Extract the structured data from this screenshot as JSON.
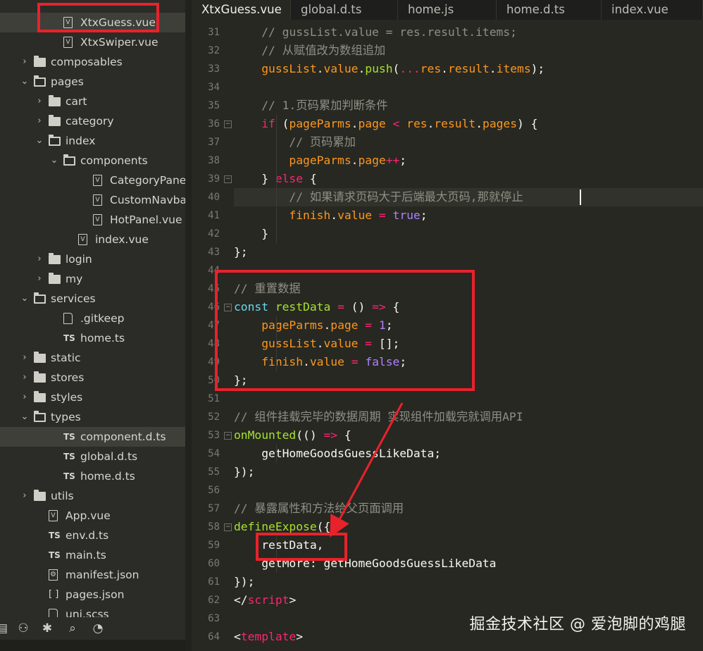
{
  "sidebar": {
    "rows": [
      {
        "label": "XtxGuess.vue",
        "type": "vue",
        "depth": 3,
        "selected": true
      },
      {
        "label": "XtxSwiper.vue",
        "type": "vue",
        "depth": 3
      },
      {
        "label": "composables",
        "type": "folder",
        "depth": 1
      },
      {
        "label": "pages",
        "type": "folder-open",
        "depth": 1
      },
      {
        "label": "cart",
        "type": "folder",
        "depth": 2
      },
      {
        "label": "category",
        "type": "folder",
        "depth": 2
      },
      {
        "label": "index",
        "type": "folder-open",
        "depth": 2
      },
      {
        "label": "components",
        "type": "folder-open",
        "depth": 3
      },
      {
        "label": "CategoryPanel...",
        "type": "vue",
        "depth": 5
      },
      {
        "label": "CustomNavbar...",
        "type": "vue",
        "depth": 5
      },
      {
        "label": "HotPanel.vue",
        "type": "vue",
        "depth": 5
      },
      {
        "label": "index.vue",
        "type": "vue",
        "depth": 4
      },
      {
        "label": "login",
        "type": "folder",
        "depth": 2
      },
      {
        "label": "my",
        "type": "folder",
        "depth": 2
      },
      {
        "label": "services",
        "type": "folder-open",
        "depth": 1
      },
      {
        "label": ".gitkeep",
        "type": "doc",
        "depth": 3
      },
      {
        "label": "home.ts",
        "type": "ts",
        "depth": 3
      },
      {
        "label": "static",
        "type": "folder",
        "depth": 1
      },
      {
        "label": "stores",
        "type": "folder",
        "depth": 1
      },
      {
        "label": "styles",
        "type": "folder",
        "depth": 1
      },
      {
        "label": "types",
        "type": "folder-open",
        "depth": 1
      },
      {
        "label": "component.d.ts",
        "type": "ts",
        "depth": 3,
        "selected": true
      },
      {
        "label": "global.d.ts",
        "type": "ts",
        "depth": 3
      },
      {
        "label": "home.d.ts",
        "type": "ts",
        "depth": 3
      },
      {
        "label": "utils",
        "type": "folder",
        "depth": 1
      },
      {
        "label": "App.vue",
        "type": "vue",
        "depth": 2
      },
      {
        "label": "env.d.ts",
        "type": "ts",
        "depth": 2
      },
      {
        "label": "main.ts",
        "type": "ts",
        "depth": 2
      },
      {
        "label": "manifest.json",
        "type": "gear",
        "depth": 2
      },
      {
        "label": "pages.json",
        "type": "bracket",
        "depth": 2
      },
      {
        "label": "uni.scss",
        "type": "doc",
        "depth": 2
      }
    ],
    "toolbar_icons": [
      "explorer-icon",
      "extensions-icon",
      "debug-icon",
      "search-icon",
      "plugin-icon"
    ]
  },
  "tabs": [
    {
      "label": "XtxGuess.vue",
      "active": true
    },
    {
      "label": "global.d.ts"
    },
    {
      "label": "home.js"
    },
    {
      "label": "home.d.ts"
    },
    {
      "label": "index.vue"
    }
  ],
  "editor": {
    "lines": [
      {
        "num": "31",
        "html": "    <span class='c'>// gussList.value = res.result.items;</span>"
      },
      {
        "num": "32",
        "html": "    <span class='c'>// 从赋值改为数组追加</span>"
      },
      {
        "num": "33",
        "html": "    <span class='p'>gussList</span>.<span class='p'>value</span>.<span class='f'>push</span>(<span class='k'>...</span><span class='p'>res</span>.<span class='p'>result</span>.<span class='p'>items</span>);"
      },
      {
        "num": "34",
        "html": ""
      },
      {
        "num": "35",
        "html": "    <span class='c'>// 1.页码累加判断条件</span>"
      },
      {
        "num": "36",
        "fold": true,
        "html": "    <span class='k'>if</span> (<span class='p'>pageParms</span>.<span class='p'>page</span> <span class='k'>&lt;</span> <span class='p'>res</span>.<span class='p'>result</span>.<span class='p'>pages</span>) {"
      },
      {
        "num": "37",
        "html": "        <span class='c'>// 页码累加</span>"
      },
      {
        "num": "38",
        "html": "        <span class='p'>pageParms</span>.<span class='p'>page</span><span class='k'>++</span>;"
      },
      {
        "num": "39",
        "fold": true,
        "html": "    } <span class='k'>else</span> {"
      },
      {
        "num": "40",
        "hl": true,
        "html": "        <span class='c'>// 如果请求页码大于后端最大页码,那就停止</span>"
      },
      {
        "num": "41",
        "html": "        <span class='p'>finish</span>.<span class='p'>value</span> <span class='k'>=</span> <span class='n'>true</span>;"
      },
      {
        "num": "42",
        "html": "    }"
      },
      {
        "num": "43",
        "html": "};"
      },
      {
        "num": "44",
        "html": ""
      },
      {
        "num": "45",
        "html": "<span class='c'>// 重置数据</span>"
      },
      {
        "num": "46",
        "fold": true,
        "html": "<span class='kw'>const</span> <span class='f'>restData</span> <span class='k'>=</span> () <span class='k'>=&gt;</span> {"
      },
      {
        "num": "47",
        "html": "    <span class='p'>pageParms</span>.<span class='p'>page</span> <span class='k'>=</span> <span class='n'>1</span>;"
      },
      {
        "num": "48",
        "html": "    <span class='p'>gussList</span>.<span class='p'>value</span> <span class='k'>=</span> [];"
      },
      {
        "num": "49",
        "html": "    <span class='p'>finish</span>.<span class='p'>value</span> <span class='k'>=</span> <span class='n'>false</span>;"
      },
      {
        "num": "50",
        "html": "};"
      },
      {
        "num": "51",
        "html": ""
      },
      {
        "num": "52",
        "html": "<span class='c'>// 组件挂载完毕的数据周期 实现组件加载完就调用API</span>"
      },
      {
        "num": "53",
        "fold": true,
        "html": "<span class='f'>onMounted</span>(() <span class='k'>=&gt;</span> {"
      },
      {
        "num": "54",
        "html": "    getHomeGoodsGuessLikeData;"
      },
      {
        "num": "55",
        "html": "});"
      },
      {
        "num": "56",
        "html": ""
      },
      {
        "num": "57",
        "html": "<span class='c'>// 暴露属性和方法给父页面调用</span>"
      },
      {
        "num": "58",
        "fold": true,
        "html": "<span class='f'>defineExpose</span>({"
      },
      {
        "num": "59",
        "html": "    restData,"
      },
      {
        "num": "60",
        "html": "    getMore: getHomeGoodsGuessLikeData"
      },
      {
        "num": "61",
        "html": "});"
      },
      {
        "num": "62",
        "html": "&lt;/<span class='k'>script</span>&gt;"
      },
      {
        "num": "63",
        "html": ""
      },
      {
        "num": "64",
        "html": "&lt;<span class='k'>template</span>&gt;"
      }
    ]
  },
  "watermark": "掘金技术社区 @ 爱泡脚的鸡腿",
  "colors": {
    "annotation": "#e8222b",
    "background": "#272822"
  }
}
